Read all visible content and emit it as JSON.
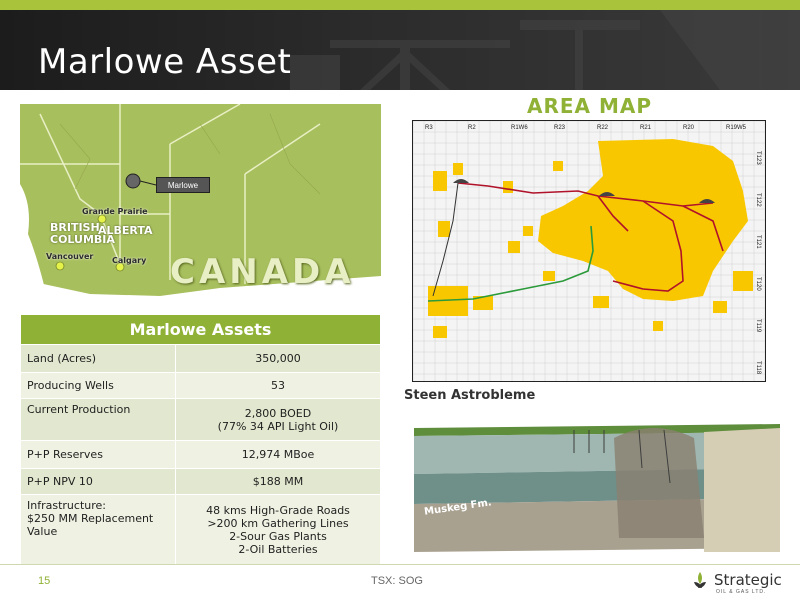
{
  "slide": {
    "title": "Marlowe Asset",
    "page_number": "15",
    "ticker": "TSX: SOG",
    "area_map_title": "AREA MAP",
    "cross_section_title": "Steen Astrobleme",
    "cross_section_label": "Muskeg Fm."
  },
  "canada_map": {
    "country_label": "CANADA",
    "province_bc": "BRITISH COLUMBIA",
    "province_ab": "ALBERTA",
    "city_grande_prairie": "Grande Prairie",
    "city_vancouver": "Vancouver",
    "city_calgary": "Calgary",
    "callout": "Marlowe"
  },
  "area_map": {
    "ranges": [
      "R3",
      "R2",
      "R1W6",
      "R23",
      "R22",
      "R21",
      "R20",
      "R19W5"
    ],
    "townships": [
      "T123",
      "T122",
      "T121",
      "T120",
      "T119",
      "T118"
    ]
  },
  "table": {
    "header": "Marlowe Assets",
    "rows": [
      {
        "label": "Land (Acres)",
        "value": "350,000"
      },
      {
        "label": "Producing Wells",
        "value": "53"
      },
      {
        "label": "Current Production",
        "value": "2,800 BOED",
        "value2": "(77% 34 API Light Oil)"
      },
      {
        "label": "P+P Reserves",
        "value": "12,974 MBoe"
      },
      {
        "label": "P+P NPV 10",
        "value": "$188 MM"
      },
      {
        "label": "Infrastructure:",
        "label2": "$250 MM Replacement",
        "label3": "Value",
        "value": "48 kms High-Grade Roads",
        "value2": ">200 km Gathering Lines",
        "value3": "2-Sour Gas Plants",
        "value4": "2-Oil Batteries"
      }
    ]
  },
  "logo": {
    "name": "Strategic",
    "sub": "OIL & GAS LTD."
  },
  "colors": {
    "accent_green": "#8fb135",
    "land_yellow": "#f9c700",
    "pipeline_red": "#b0122a",
    "pipeline_green": "#2b9a3a"
  }
}
